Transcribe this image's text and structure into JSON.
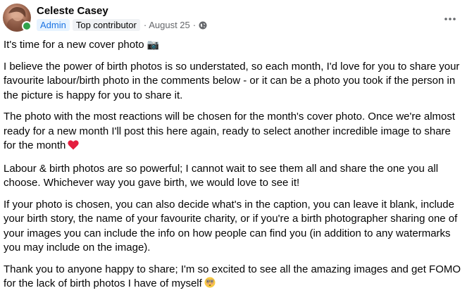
{
  "author": {
    "name": "Celeste Casey",
    "badges": [
      "Admin",
      "Top contributor"
    ],
    "separator": "·",
    "date": "August 25",
    "separator2": "·",
    "privacy_icon": "globe-icon"
  },
  "menu": {
    "more_icon": "more-horizontal-icon"
  },
  "post": {
    "title": "It's time for a new cover photo",
    "title_emoji": "📷",
    "p1": "I believe the power of birth photos is so understated, so each month, I'd love for you to share your favourite labour/birth photo in the comments below - or it can be a photo you took if the person in the picture is happy for you to share it.",
    "p2": "The photo with the most reactions will be chosen for the month's cover photo. Once we're almost ready for a new month I'll post this here again, ready to select another incredible image to share for the month",
    "p2_emoji": "heart-emoji",
    "p3": "Labour & birth photos are so powerful; I cannot wait to see them all and share the one you all choose. Whichever way you gave birth, we would love to see it!",
    "p4": "If your photo is chosen, you can also decide what's in the caption, you can leave it blank, include your birth story, the name of your favourite charity, or if you're a birth photographer sharing one of your images you can include the info on how people can find you (in addition to any watermarks you may include on the image).",
    "p5": "Thank you to anyone happy to share; I'm so excited to see all the amazing images and get FOMO for the lack of birth photos I have of myself",
    "p5_emoji": "flushed-face-emoji"
  },
  "colors": {
    "online": "#31a24c",
    "admin_badge_bg": "#e7f3ff",
    "admin_badge_text": "#1b74e4",
    "heart": "#e41e3f"
  }
}
